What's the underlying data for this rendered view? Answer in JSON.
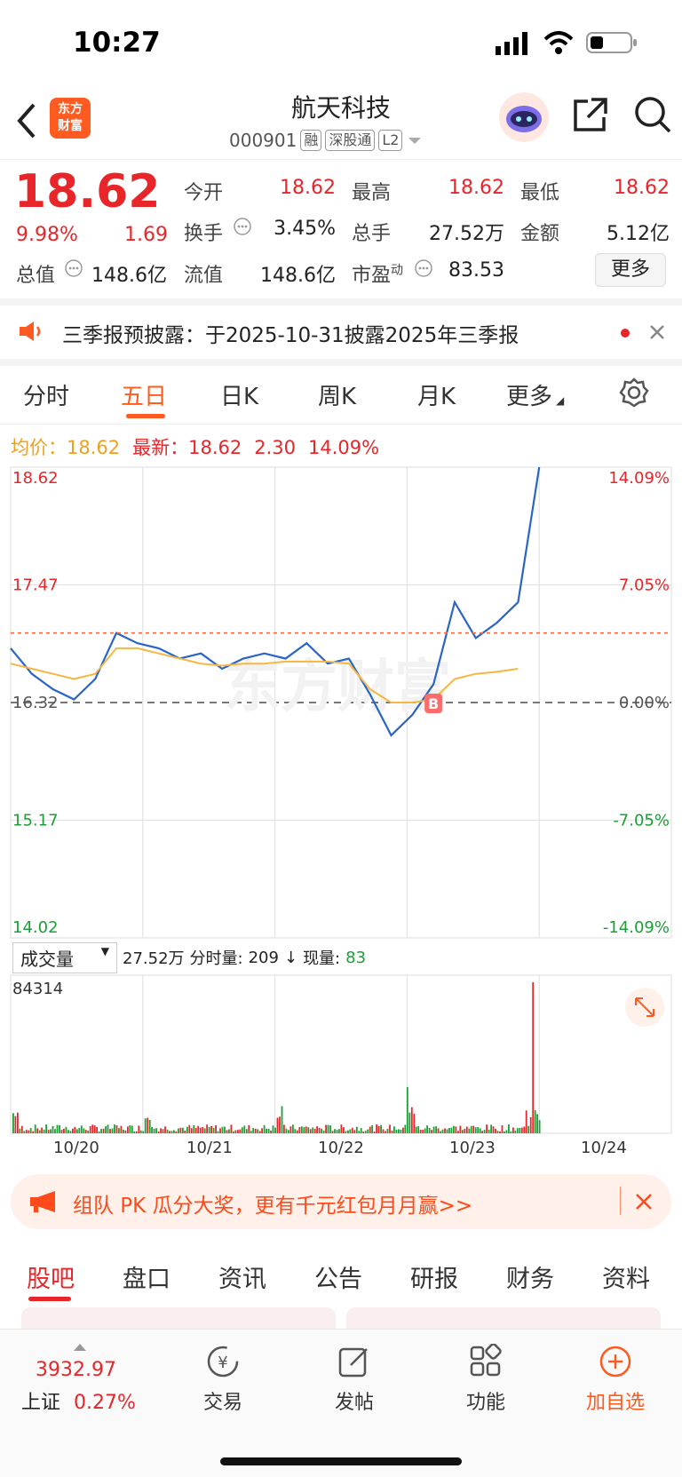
{
  "status_bar": {
    "time": "10:27"
  },
  "header": {
    "logo": [
      "东方",
      "财富"
    ],
    "title": "航天科技",
    "code": "000901",
    "tags": [
      "融",
      "深股通",
      "L2"
    ]
  },
  "quote": {
    "price": "18.62",
    "change_pct": "9.98%",
    "change": "1.69",
    "fields": [
      {
        "label": "今开",
        "value": "18.62",
        "color": "red"
      },
      {
        "label": "最高",
        "value": "18.62",
        "color": "red"
      },
      {
        "label": "最低",
        "value": "18.62",
        "color": "red"
      },
      {
        "label": "换手",
        "value": "3.45%",
        "color": "dark"
      },
      {
        "label": "总手",
        "value": "27.52万",
        "color": "dark"
      },
      {
        "label": "金额",
        "value": "5.12亿",
        "color": "dark"
      },
      {
        "label": "总值",
        "value": "148.6亿",
        "color": "dark"
      },
      {
        "label": "流值",
        "value": "148.6亿",
        "color": "dark"
      },
      {
        "label": "市盈",
        "sup": "动",
        "value": "83.53",
        "color": "dark"
      }
    ],
    "more_label": "更多"
  },
  "notice": {
    "text": "三季报预披露：于2025-10-31披露2025年三季报"
  },
  "tabs": [
    "分时",
    "五日",
    "日K",
    "周K",
    "月K",
    "更多"
  ],
  "active_tab": "五日",
  "chart_legend": {
    "avg_label": "均价：",
    "avg_value": "18.62",
    "latest_label": "最新：",
    "latest_value": "18.62",
    "latest_change": "2.30",
    "latest_pct": "14.09%"
  },
  "chart_data": {
    "type": "line",
    "title": "",
    "x": [
      "10/20",
      "10/21",
      "10/22",
      "10/23",
      "10/24"
    ],
    "y_ticks_left": [
      "18.62",
      "17.47",
      "16.32",
      "15.17",
      "14.02"
    ],
    "y_ticks_right": [
      "14.09%",
      "7.05%",
      "0.00%",
      "-7.05%",
      "-14.09%"
    ],
    "ylim": [
      14.02,
      18.62
    ],
    "reference_price": 16.32,
    "series": [
      {
        "values": [
          16.85,
          16.6,
          16.45,
          16.35,
          16.55,
          17.0,
          16.9,
          16.85,
          16.75,
          16.8,
          16.65,
          16.75,
          16.8,
          16.75,
          16.9,
          16.7,
          16.75,
          16.4,
          16.0,
          16.2,
          16.5,
          17.3,
          16.95,
          17.1,
          17.3,
          18.62
        ]
      },
      {
        "values": [
          16.7,
          16.65,
          16.6,
          16.55,
          16.6,
          16.85,
          16.85,
          16.8,
          16.75,
          16.7,
          16.68,
          16.7,
          16.7,
          16.72,
          16.72,
          16.72,
          16.7,
          16.45,
          16.32,
          16.32,
          16.35,
          16.55,
          16.6,
          16.62,
          16.65
        ]
      }
    ],
    "annotations": [
      "B"
    ]
  },
  "volume": {
    "selector_label": "成交量",
    "total": "27.52万",
    "period_label": "分时量:",
    "period_value": "209",
    "arrow": "↓",
    "now_label": "现量:",
    "now_value": "83",
    "max_label": "84314"
  },
  "promo": {
    "text": "组队 PK 瓜分大奖，更有千元红包月月赢>>"
  },
  "bottom_tabs": [
    "股吧",
    "盘口",
    "资讯",
    "公告",
    "研报",
    "财务",
    "资料"
  ],
  "bottom_nav": {
    "index_value": "3932.97",
    "index_name": "上证",
    "index_pct": "0.27%",
    "items": [
      "交易",
      "发帖",
      "功能",
      "加自选"
    ]
  }
}
